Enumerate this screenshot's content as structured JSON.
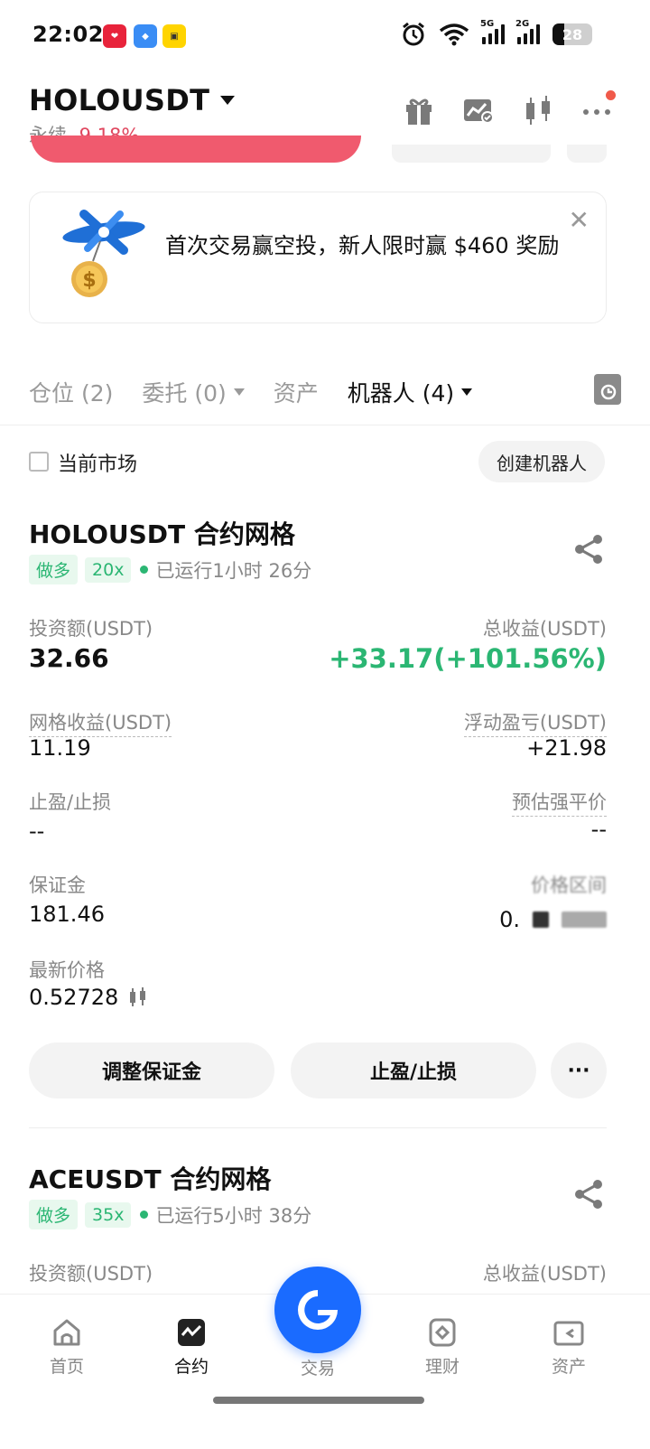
{
  "status_bar": {
    "time": "22:02",
    "signal_1_tag": "5G",
    "signal_2_tag": "2G",
    "battery": "28"
  },
  "header": {
    "symbol": "HOLOUSDT",
    "contract_type": "永续",
    "change": "-9.18%"
  },
  "banner": {
    "text": "首次交易赢空投，新人限时赢 $460 奖励"
  },
  "tabs": [
    {
      "label": "仓位 (2)"
    },
    {
      "label": "委托 (0)"
    },
    {
      "label": "资产"
    },
    {
      "label": "机器人 (4)"
    }
  ],
  "filter": {
    "current_market": "当前市场",
    "create_bot": "创建机器人"
  },
  "bots": [
    {
      "title": "HOLOUSDT 合约网格",
      "side": "做多",
      "leverage": "20x",
      "runtime": "已运行1小时 26分",
      "investment_label": "投资额(USDT)",
      "investment": "32.66",
      "total_pnl_label": "总收益(USDT)",
      "total_pnl": "+33.17(+101.56%)",
      "grid_pnl_label": "网格收益(USDT)",
      "grid_pnl": "11.19",
      "floating_pnl_label": "浮动盈亏(USDT)",
      "floating_pnl": "+21.98",
      "tpsl_label": "止盈/止损",
      "tpsl": "--",
      "liq_label": "预估强平价",
      "liq": "--",
      "margin_label": "保证金",
      "margin": "181.46",
      "range_label": "价格区间",
      "range_prefix": "0.",
      "last_price_label": "最新价格",
      "last_price": "0.52728"
    },
    {
      "title": "ACEUSDT 合约网格",
      "side": "做多",
      "leverage": "35x",
      "runtime": "已运行5小时 38分",
      "investment_label": "投资额(USDT)",
      "total_pnl_label": "总收益(USDT)"
    }
  ],
  "actions": {
    "adjust_margin": "调整保证金",
    "tpsl": "止盈/止损",
    "more": "···"
  },
  "nav": [
    {
      "label": "首页"
    },
    {
      "label": "合约"
    },
    {
      "label": "交易"
    },
    {
      "label": "理财"
    },
    {
      "label": "资产"
    }
  ],
  "colors": {
    "green": "#2bb673",
    "red": "#e0475f",
    "brand_blue": "#1a6bff"
  }
}
